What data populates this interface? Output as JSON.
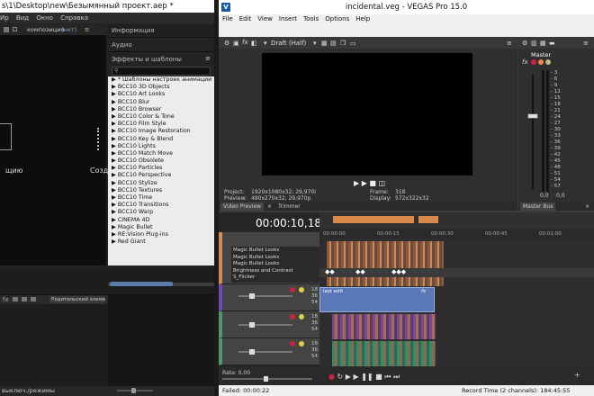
{
  "ae": {
    "title": "s\\1\\Desktop\\new\\Безымянный проект.aep *",
    "menu": [
      "Ир",
      "Вид",
      "Окно",
      "Справка"
    ],
    "comp_tab_prefix": "композиция",
    "comp_tab_value": "(нет)",
    "comp_text_left": "щию",
    "comp_text_right": "Созд",
    "panel_info": "Информация",
    "panel_audio": "Аудио",
    "panel_effects": "Эффекты и шаблоны",
    "effects": [
      "* Шаблоны настроек анимации",
      "BCC10 3D Objects",
      "BCC10 Art Looks",
      "BCC10 Blur",
      "BCC10 Browser",
      "BCC10 Color & Tone",
      "BCC10 Film Style",
      "BCC10 Image Restoration",
      "BCC10 Key & Blend",
      "BCC10 Lights",
      "BCC10 Match Move",
      "BCC10 Obsolete",
      "BCC10 Particles",
      "BCC10 Perspective",
      "BCC10 Stylize",
      "BCC10 Textures",
      "BCC10 Time",
      "BCC10 Transitions",
      "BCC10 Warp",
      "CINEMA 4D",
      "Magic Bullet",
      "RE:Vision Plug-ins",
      "Red Giant"
    ],
    "parent_label": "Родительский элемент и...",
    "status": "выключ./режимы"
  },
  "vegas": {
    "title": "incidental.veg - VEGAS Pro 15.0",
    "menu": [
      "File",
      "Edit",
      "View",
      "Insert",
      "Tools",
      "Options",
      "Help"
    ],
    "preview_quality": "Draft (Half)",
    "project_label": "Project:",
    "project_value": "1920x1080x32; 29,970i",
    "preview_label": "Preview:",
    "preview_value": "480x270x32; 29,970p",
    "frame_label": "Frame:",
    "frame_value": "318",
    "display_label": "Display:",
    "display_value": "572x322x32",
    "tab_video_preview": "Video Preview",
    "tab_trimmer": "Trimmer",
    "master_label": "Master",
    "tab_master_bus": "Master Bus",
    "meter_scale": [
      "3",
      "6",
      "9",
      "12",
      "15",
      "18",
      "21",
      "24",
      "27",
      "30",
      "33",
      "36",
      "39",
      "42",
      "45",
      "48",
      "51",
      "54",
      "57"
    ],
    "meter_values": [
      "0,0",
      "0,0"
    ],
    "timecode": "00:00:10,18",
    "ruler": [
      "00:00:00",
      "00:00:15",
      "00:00:30",
      "00:00:45",
      "00:01:00"
    ],
    "fx_chain": [
      "Magic Bullet Looks",
      "Magic Bullet Looks",
      "Magic Bullet Looks",
      "Brightness and Contrast",
      "S_Flicker"
    ],
    "clip_label": "last edit",
    "track_num": [
      "18",
      "36",
      "54"
    ],
    "rate": "Rate: 0,00",
    "status_left": "Failed: 00:00:22",
    "status_right": "Record Time (2 channels): 184:45:55",
    "accent_orange": "#d98a4a",
    "accent_blue": "#5a78b8"
  }
}
